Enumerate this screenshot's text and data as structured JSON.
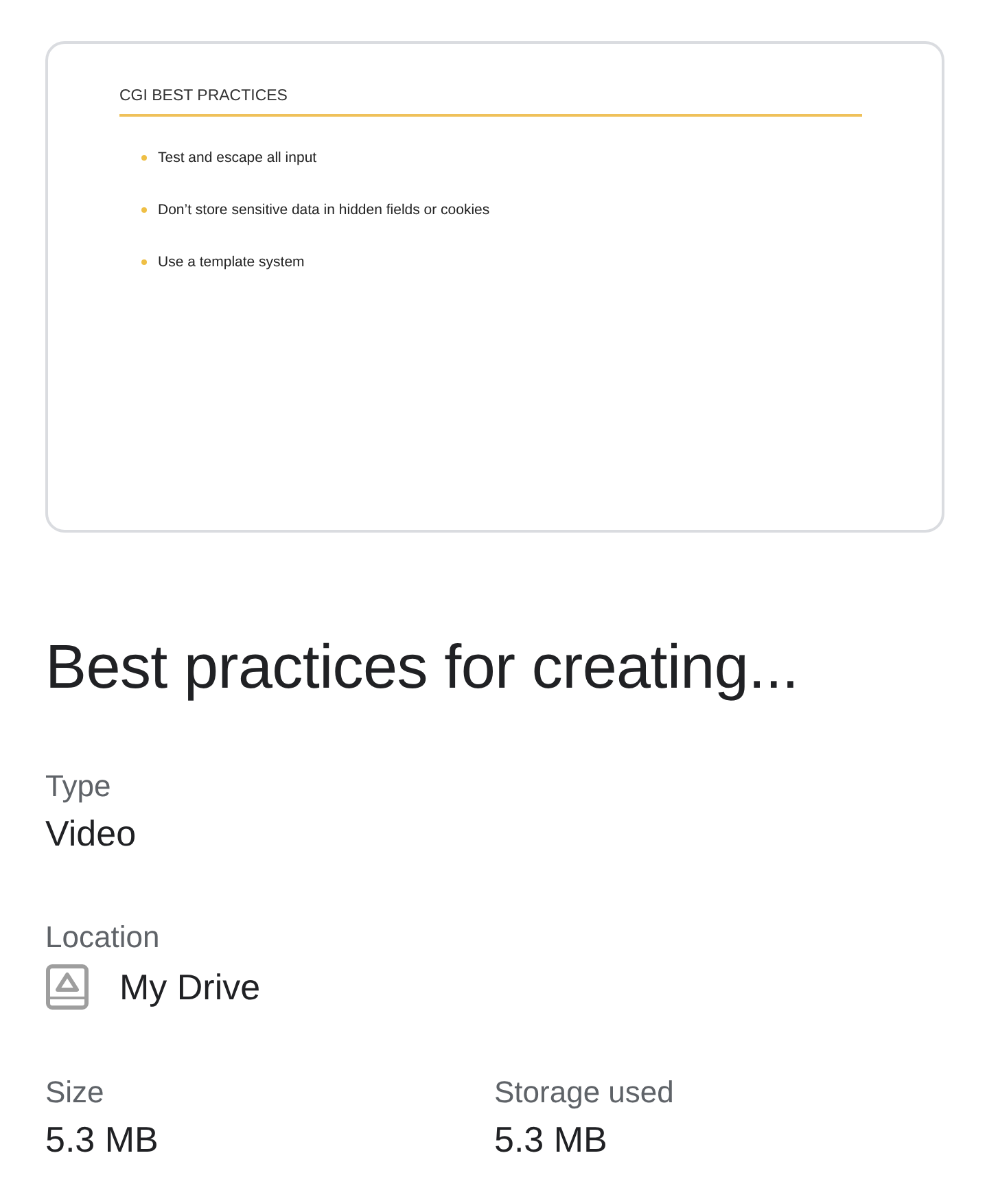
{
  "preview": {
    "slide_title": "CGI BEST PRACTICES",
    "bullets": [
      "Test and escape all input",
      "Don’t store sensitive data in hidden fields or cookies",
      "Use a template system"
    ]
  },
  "title": "Best practices for creating...",
  "details": [
    {
      "label": "Type",
      "value": "Video",
      "kind": "plain"
    },
    {
      "label": "Location",
      "value": "My Drive",
      "kind": "drive"
    }
  ],
  "pair": [
    {
      "label": "Size",
      "value": "5.3 MB"
    },
    {
      "label": "Storage used",
      "value": "5.3 MB"
    }
  ]
}
